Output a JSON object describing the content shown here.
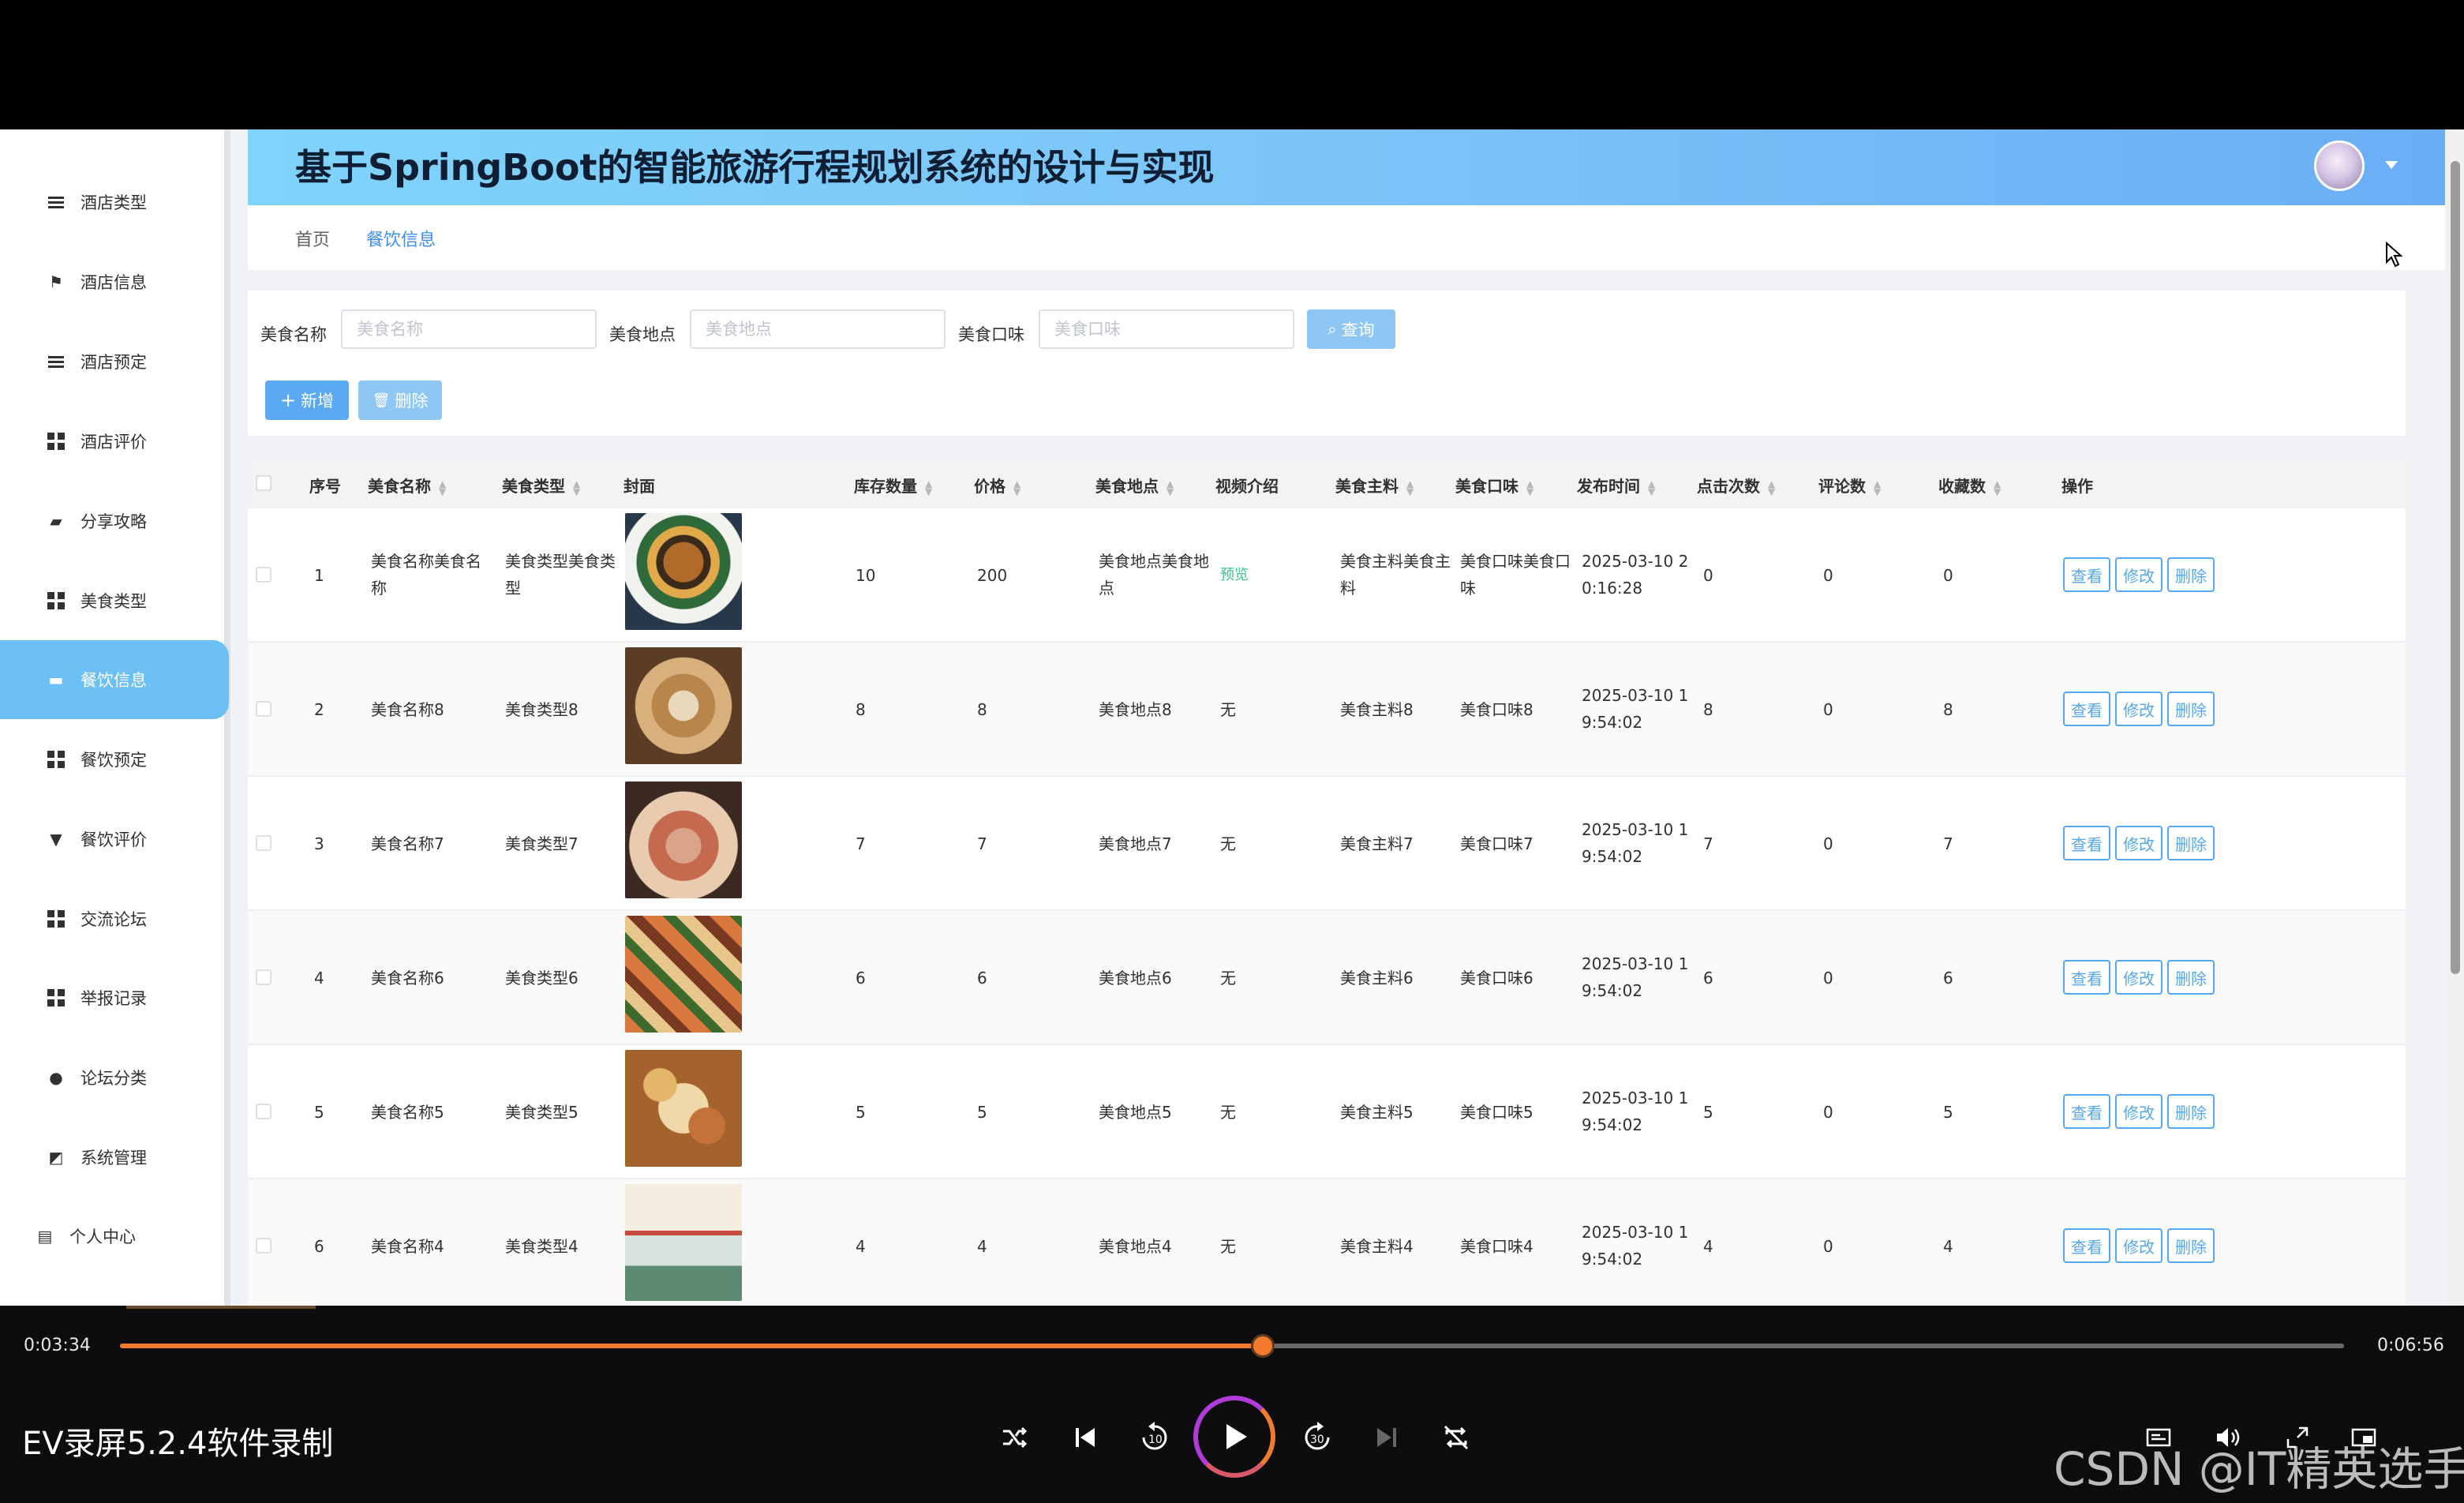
{
  "header": {
    "title": "基于SpringBoot的智能旅游行程规划系统的设计与实现"
  },
  "breadcrumb": {
    "home": "首页",
    "current": "餐饮信息"
  },
  "sidebar": {
    "items": [
      {
        "label": "酒店类型",
        "icon": "list-icon"
      },
      {
        "label": "酒店信息",
        "icon": "flag-icon"
      },
      {
        "label": "酒店预定",
        "icon": "list-icon"
      },
      {
        "label": "酒店评价",
        "icon": "grid-icon"
      },
      {
        "label": "分享攻略",
        "icon": "thumb-icon"
      },
      {
        "label": "美食类型",
        "icon": "grid-icon"
      },
      {
        "label": "餐饮信息",
        "icon": "monitor-icon",
        "active": true
      },
      {
        "label": "餐饮预定",
        "icon": "grid-icon"
      },
      {
        "label": "餐饮评价",
        "icon": "pin-icon"
      },
      {
        "label": "交流论坛",
        "icon": "grid-icon"
      },
      {
        "label": "举报记录",
        "icon": "grid-icon"
      },
      {
        "label": "论坛分类",
        "icon": "user-icon"
      },
      {
        "label": "系统管理",
        "icon": "chart-icon"
      },
      {
        "label": "个人中心",
        "icon": "card-icon"
      }
    ],
    "active_color": "#6cc0f6"
  },
  "search": {
    "name_label": "美食名称",
    "name_placeholder": "美食名称",
    "place_label": "美食地点",
    "place_placeholder": "美食地点",
    "taste_label": "美食口味",
    "taste_placeholder": "美食口味",
    "query_button": "查询"
  },
  "actions": {
    "add_button": "新增",
    "delete_button": "删除"
  },
  "table": {
    "headers": [
      "序号",
      "美食名称",
      "美食类型",
      "封面",
      "库存数量",
      "价格",
      "美食地点",
      "视频介绍",
      "美食主料",
      "美食口味",
      "发布时间",
      "点击次数",
      "评论数",
      "收藏数",
      "操作"
    ],
    "op_labels": {
      "view": "查看",
      "edit": "修改",
      "delete": "删除"
    },
    "rows": [
      {
        "no": "1",
        "name": "美食名称美食名称",
        "type": "美食类型美食类型",
        "stock": "10",
        "price": "200",
        "place": "美食地点美食地点",
        "video": "预览",
        "ingredient": "美食主料美食主料",
        "taste": "美食口味美食口味",
        "time": "2025-03-10 20:16:28",
        "clicks": "0",
        "comments": "0",
        "favs": "0"
      },
      {
        "no": "2",
        "name": "美食名称8",
        "type": "美食类型8",
        "stock": "8",
        "price": "8",
        "place": "美食地点8",
        "video": "无",
        "ingredient": "美食主料8",
        "taste": "美食口味8",
        "time": "2025-03-10 19:54:02",
        "clicks": "8",
        "comments": "0",
        "favs": "8"
      },
      {
        "no": "3",
        "name": "美食名称7",
        "type": "美食类型7",
        "stock": "7",
        "price": "7",
        "place": "美食地点7",
        "video": "无",
        "ingredient": "美食主料7",
        "taste": "美食口味7",
        "time": "2025-03-10 19:54:02",
        "clicks": "7",
        "comments": "0",
        "favs": "7"
      },
      {
        "no": "4",
        "name": "美食名称6",
        "type": "美食类型6",
        "stock": "6",
        "price": "6",
        "place": "美食地点6",
        "video": "无",
        "ingredient": "美食主料6",
        "taste": "美食口味6",
        "time": "2025-03-10 19:54:02",
        "clicks": "6",
        "comments": "0",
        "favs": "6"
      },
      {
        "no": "5",
        "name": "美食名称5",
        "type": "美食类型5",
        "stock": "5",
        "price": "5",
        "place": "美食地点5",
        "video": "无",
        "ingredient": "美食主料5",
        "taste": "美食口味5",
        "time": "2025-03-10 19:54:02",
        "clicks": "5",
        "comments": "0",
        "favs": "5"
      },
      {
        "no": "6",
        "name": "美食名称4",
        "type": "美食类型4",
        "stock": "4",
        "price": "4",
        "place": "美食地点4",
        "video": "无",
        "ingredient": "美食主料4",
        "taste": "美食口味4",
        "time": "2025-03-10 19:54:02",
        "clicks": "4",
        "comments": "0",
        "favs": "4"
      }
    ]
  },
  "player": {
    "current_time": "0:03:34",
    "total_time": "0:06:56",
    "progress": 0.514,
    "recorder_label": "EV录屏5.2.4软件录制",
    "watermark": "CSDN @IT精英选手",
    "accent_color": "#f07a2e"
  }
}
